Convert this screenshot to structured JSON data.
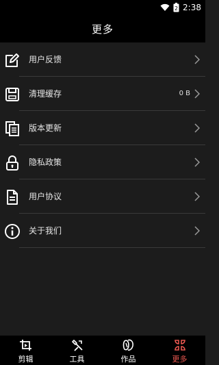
{
  "status_bar": {
    "time": "2:38",
    "battery_level": "2"
  },
  "header": {
    "title": "更多"
  },
  "menu": {
    "items": [
      {
        "label": "用户反馈",
        "value": "",
        "icon": "edit-icon"
      },
      {
        "label": "清理缓存",
        "value": "0 B",
        "icon": "save-icon"
      },
      {
        "label": "版本更新",
        "value": "",
        "icon": "documents-icon"
      },
      {
        "label": "隐私政策",
        "value": "",
        "icon": "lock-icon"
      },
      {
        "label": "用户协议",
        "value": "",
        "icon": "document-icon"
      },
      {
        "label": "关于我们",
        "value": "",
        "icon": "info-icon"
      }
    ]
  },
  "tabbar": {
    "tabs": [
      {
        "label": "剪辑",
        "icon": "crop-icon"
      },
      {
        "label": "工具",
        "icon": "tool-icon"
      },
      {
        "label": "作品",
        "icon": "works-icon"
      },
      {
        "label": "更多",
        "icon": "more-icon",
        "active": true
      }
    ],
    "active_color": "#e8574f"
  }
}
